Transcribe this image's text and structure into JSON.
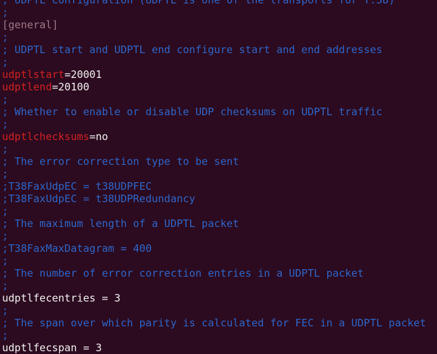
{
  "colors": {
    "background": "#2c0a1f",
    "comment": "#2e66c9",
    "section": "#a07888",
    "key": "#d22222",
    "text": "#f2f2f2"
  },
  "lines": [
    {
      "type": "comment",
      "text": "; UDPTL Configuration (UDPTL is one of the transports for T.38)"
    },
    {
      "type": "comment",
      "text": ";"
    },
    {
      "type": "section",
      "text": "[general]"
    },
    {
      "type": "comment",
      "text": ";"
    },
    {
      "type": "comment",
      "text": "; UDPTL start and UDPTL end configure start and end addresses"
    },
    {
      "type": "comment",
      "text": ";"
    },
    {
      "type": "kv",
      "key": "udptlstart",
      "sep": "=",
      "value": "20001"
    },
    {
      "type": "kv",
      "key": "udptlend",
      "sep": "=",
      "value": "20100"
    },
    {
      "type": "comment",
      "text": ";"
    },
    {
      "type": "comment",
      "text": "; Whether to enable or disable UDP checksums on UDPTL traffic"
    },
    {
      "type": "comment",
      "text": ";"
    },
    {
      "type": "kv",
      "key": "udptlchecksums",
      "sep": "=",
      "value": "no"
    },
    {
      "type": "comment",
      "text": ";"
    },
    {
      "type": "comment",
      "text": "; The error correction type to be sent"
    },
    {
      "type": "comment",
      "text": ";"
    },
    {
      "type": "comment",
      "text": ";T38FaxUdpEC = t38UDPFEC"
    },
    {
      "type": "comment",
      "text": ";T38FaxUdpEC = t38UDPRedundancy"
    },
    {
      "type": "comment",
      "text": ";"
    },
    {
      "type": "comment",
      "text": "; The maximum length of a UDPTL packet"
    },
    {
      "type": "comment",
      "text": ";"
    },
    {
      "type": "comment",
      "text": ";T38FaxMaxDatagram = 400"
    },
    {
      "type": "comment",
      "text": ";"
    },
    {
      "type": "comment",
      "text": "; The number of error correction entries in a UDPTL packet"
    },
    {
      "type": "comment",
      "text": ";"
    },
    {
      "type": "plain",
      "text": "udptlfecentries = 3"
    },
    {
      "type": "comment",
      "text": ";"
    },
    {
      "type": "comment",
      "text": "; The span over which parity is calculated for FEC in a UDPTL packet"
    },
    {
      "type": "comment",
      "text": ";"
    },
    {
      "type": "plain",
      "text": "udptlfecspan = 3"
    }
  ]
}
